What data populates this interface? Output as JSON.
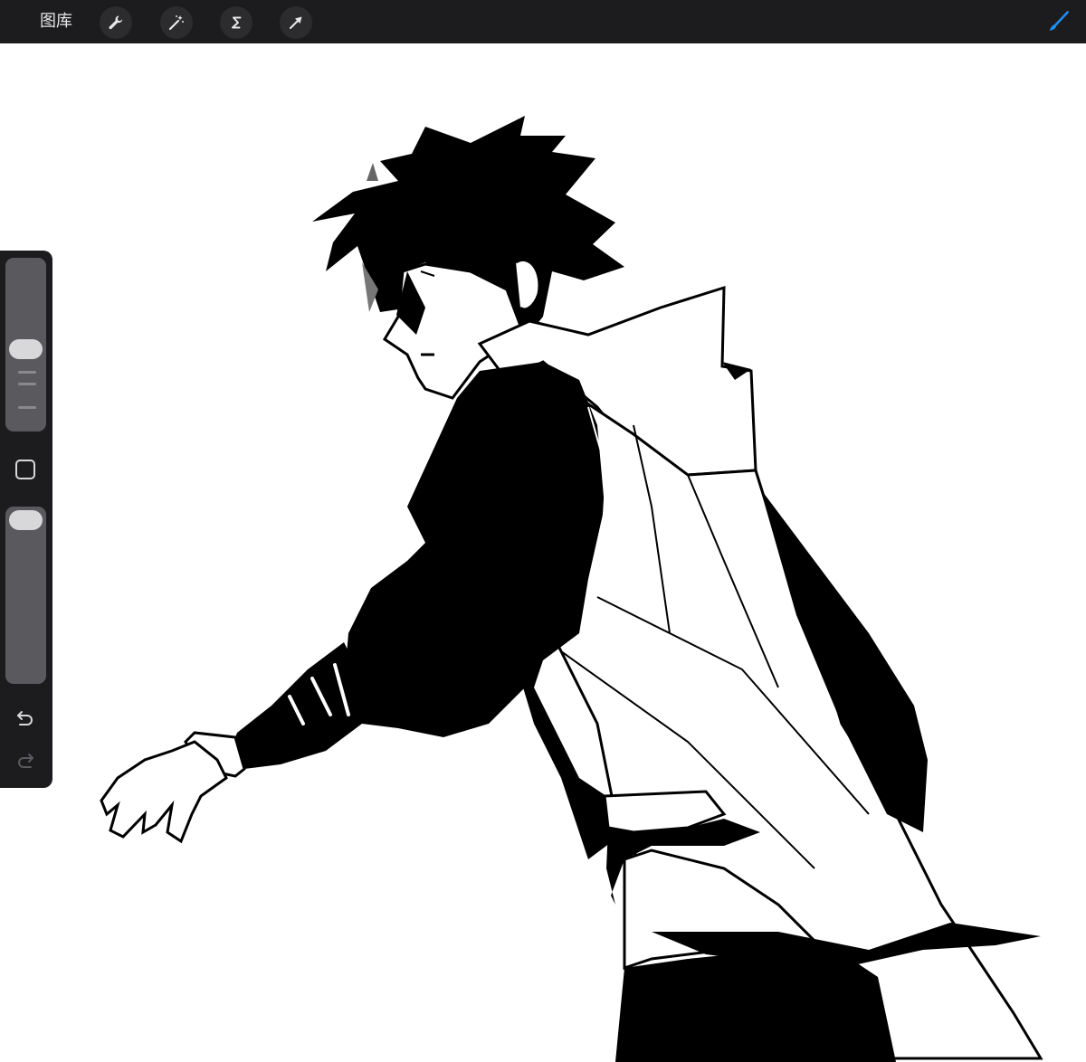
{
  "topbar": {
    "gallery_label": "图库",
    "tools": [
      {
        "name": "actions",
        "icon": "wrench-icon"
      },
      {
        "name": "adjustments",
        "icon": "magic-wand-icon"
      },
      {
        "name": "selection",
        "icon": "selection-s-icon"
      },
      {
        "name": "transform",
        "icon": "arrow-cursor-icon"
      }
    ],
    "active_tool": {
      "name": "brush",
      "icon": "brush-icon",
      "color": "#1e8ef0"
    }
  },
  "sidebar": {
    "brush_size": {
      "icon": "slider-thumb",
      "level": 0.48
    },
    "modify_button": {
      "icon": "square-icon"
    },
    "opacity": {
      "icon": "slider-thumb",
      "level": 0.97
    },
    "undo": {
      "icon": "undo-icon"
    },
    "redo": {
      "icon": "redo-icon",
      "enabled": false
    }
  },
  "canvas": {
    "background": "#ffffff",
    "content": "ink-drawing"
  },
  "colors": {
    "toolbar_bg": "#1c1c1e",
    "accent": "#1e8ef0",
    "ink": "#000000"
  }
}
